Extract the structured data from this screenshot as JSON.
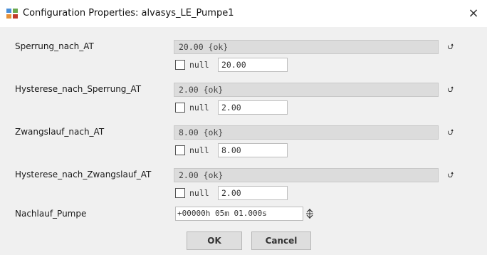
{
  "window": {
    "title": "Configuration Properties: alvasys_LE_Pumpe1",
    "close_glyph": "×",
    "icon": "config-app-icon"
  },
  "properties": [
    {
      "label": "Sperrung_nach_AT",
      "status_value": "20.00 {ok}",
      "null_label": "null",
      "value": "20.00"
    },
    {
      "label": "Hysterese_nach_Sperrung_AT",
      "status_value": "2.00 {ok}",
      "null_label": "null",
      "value": "2.00"
    },
    {
      "label": "Zwangslauf_nach_AT",
      "status_value": "8.00 {ok}",
      "null_label": "null",
      "value": "8.00"
    },
    {
      "label": "Hysterese_nach_Zwangslauf_AT",
      "status_value": "2.00 {ok}",
      "null_label": "null",
      "value": "2.00"
    }
  ],
  "nachlauf": {
    "label": "Nachlauf_Pumpe",
    "value": "+00000h 05m 01.000s"
  },
  "buttons": {
    "ok_label": "OK",
    "cancel_label": "Cancel"
  },
  "icons": {
    "expand": "double-chevron-up-icon",
    "spinner": "spinner-icon"
  }
}
